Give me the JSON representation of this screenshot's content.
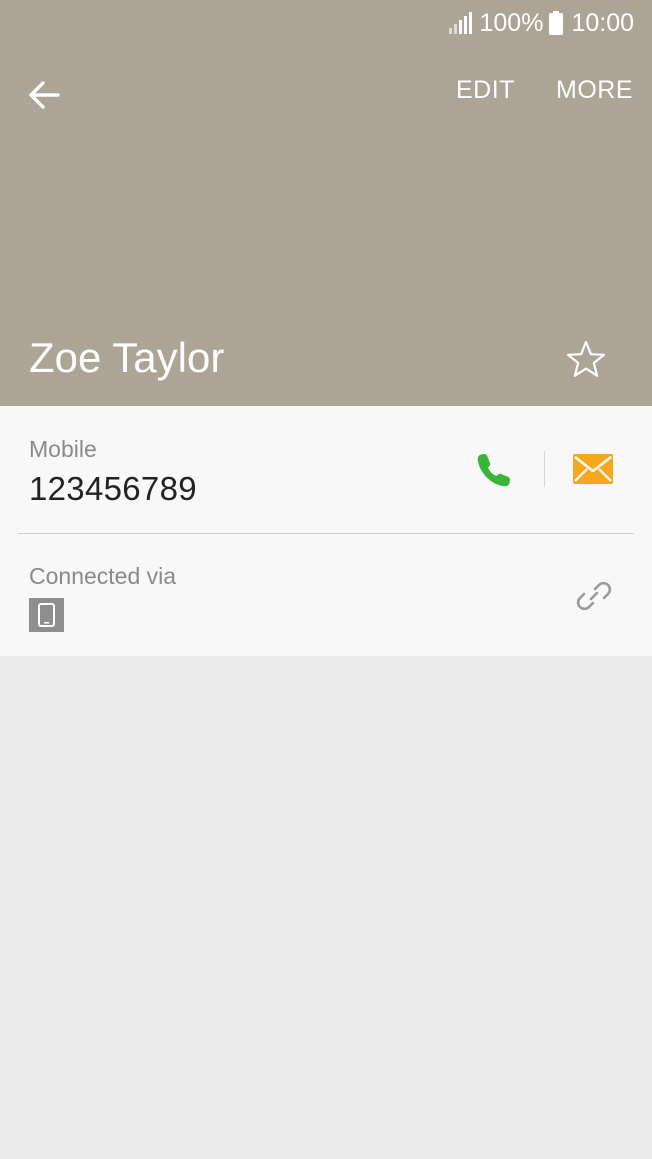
{
  "status_bar": {
    "battery": "100%",
    "time": "10:00",
    "icons": [
      "signal-icon",
      "battery-icon"
    ]
  },
  "toolbar": {
    "back_icon": "back-arrow-icon",
    "edit_label": "EDIT",
    "more_label": "MORE"
  },
  "contact": {
    "name": "Zoe Taylor",
    "favorite_icon": "star-outline-icon"
  },
  "phone": {
    "label": "Mobile",
    "number": "123456789",
    "call_icon": "phone-icon",
    "message_icon": "envelope-icon"
  },
  "connected": {
    "label": "Connected via",
    "device_icon": "tablet-device-icon",
    "link_icon": "link-icon"
  },
  "colors": {
    "header_bg": "#aca595",
    "card_bg": "#f8f8f8",
    "page_bg": "#ebebeb",
    "call_green": "#3ab53a",
    "message_orange": "#f6a71d"
  }
}
